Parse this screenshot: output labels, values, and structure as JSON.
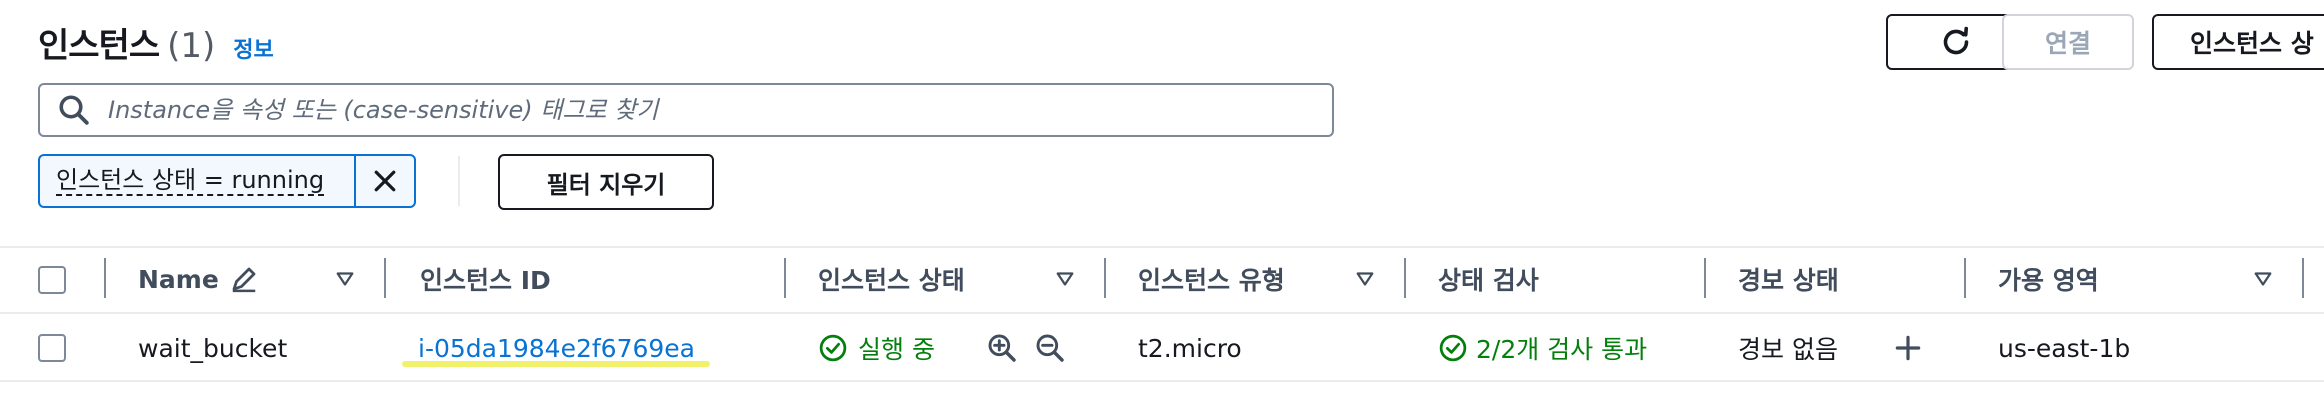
{
  "header": {
    "title": "인스턴스",
    "count": "(1)",
    "info_link": "정보",
    "refresh_icon": "refresh-icon",
    "connect_label": "연결",
    "state_button_label": "인스턴스 상"
  },
  "search": {
    "placeholder": "Instance을 속성 또는 (case-sensitive) 태그로 찾기",
    "value": "",
    "icon": "search-icon"
  },
  "filters": {
    "tokens": [
      {
        "label": "인스턴스 상태 = running"
      }
    ],
    "clear_label": "필터 지우기"
  },
  "table": {
    "columns": {
      "name": "Name",
      "instance_id": "인스턴스 ID",
      "instance_state": "인스턴스 상태",
      "instance_type": "인스턴스 유형",
      "status_check": "상태 검사",
      "alarm_status": "경보 상태",
      "availability_zone": "가용 영역"
    },
    "rows": [
      {
        "name": "wait_bucket",
        "instance_id": "i-05da1984e2f6769ea",
        "instance_state": "실행 중",
        "instance_type": "t2.micro",
        "status_check": "2/2개 검사 통과",
        "alarm_status": "경보 없음",
        "availability_zone": "us-east-1b"
      }
    ]
  },
  "colors": {
    "accent": "#0972d3",
    "success": "#037f0c",
    "text": "#16191f"
  }
}
